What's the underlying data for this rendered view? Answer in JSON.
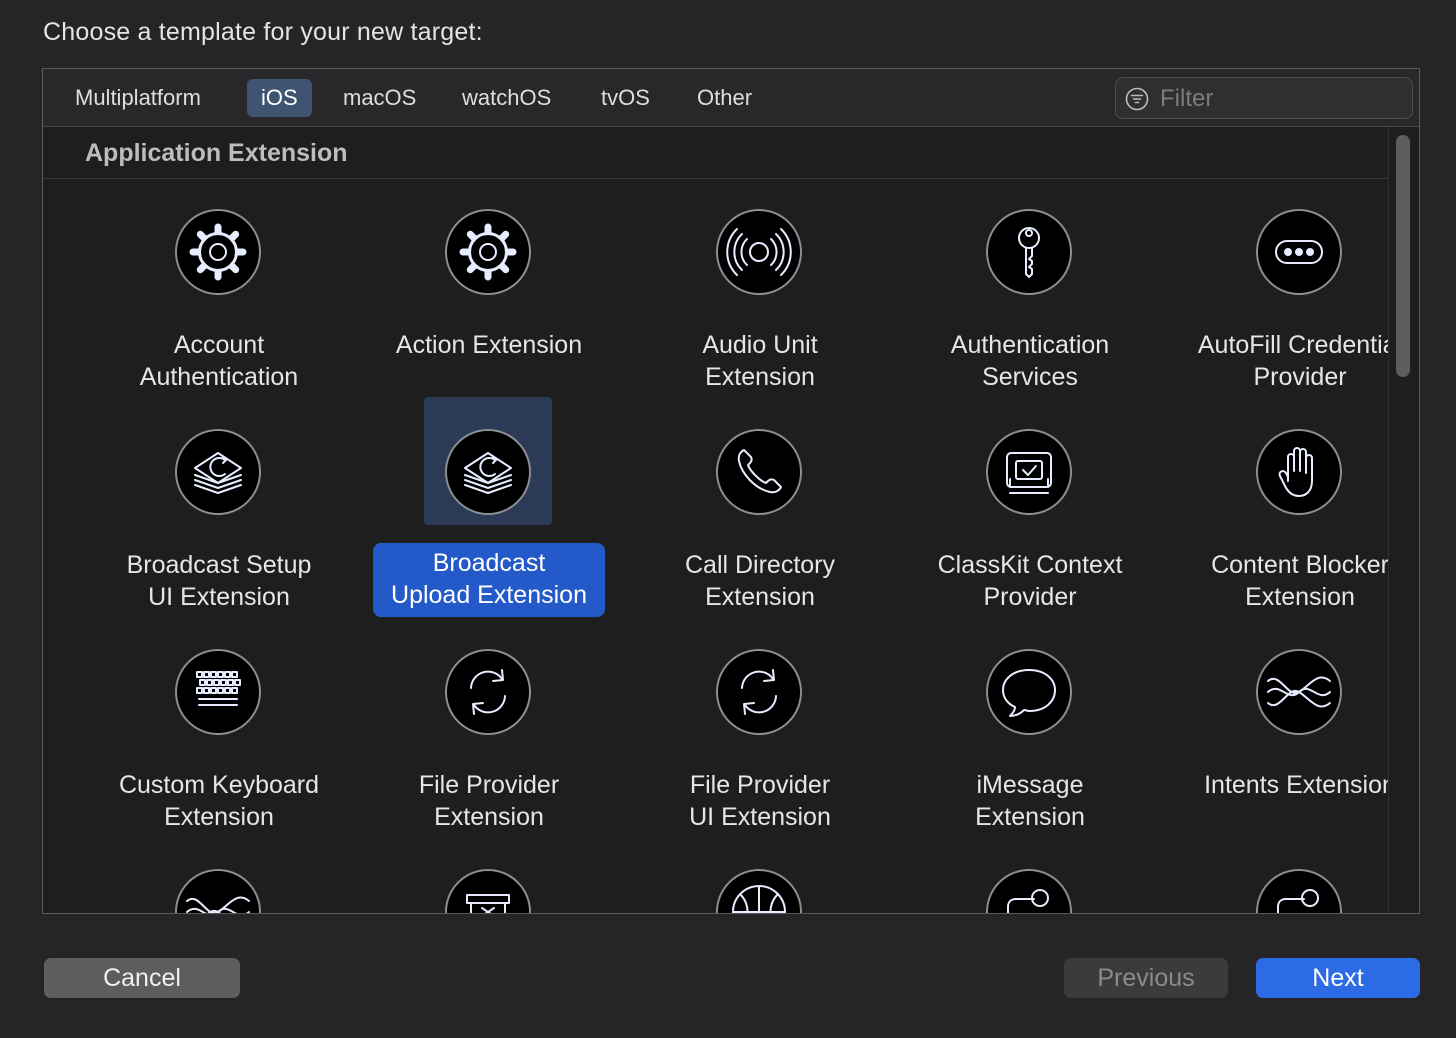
{
  "prompt": "Choose a template for your new target:",
  "tabs": [
    {
      "label": "Multiplatform",
      "active": false
    },
    {
      "label": "iOS",
      "active": true
    },
    {
      "label": "macOS",
      "active": false
    },
    {
      "label": "watchOS",
      "active": false
    },
    {
      "label": "tvOS",
      "active": false
    },
    {
      "label": "Other",
      "active": false
    }
  ],
  "filter": {
    "placeholder": "Filter",
    "value": "",
    "icon": "filter-icon"
  },
  "section": {
    "title": "Application Extension"
  },
  "templates": [
    {
      "label": "Account\nAuthentication",
      "icon": "gear-icon"
    },
    {
      "label": "Action Extension",
      "icon": "gear-icon"
    },
    {
      "label": "Audio Unit\nExtension",
      "icon": "audio-waves-icon"
    },
    {
      "label": "Authentication\nServices",
      "icon": "key-icon"
    },
    {
      "label": "AutoFill Credential\nProvider",
      "icon": "password-dots-icon"
    },
    {
      "label": "Broadcast Setup\nUI Extension",
      "icon": "broadcast-stack-icon"
    },
    {
      "label": "Broadcast\nUpload Extension",
      "icon": "broadcast-stack-icon",
      "selected": true
    },
    {
      "label": "Call Directory\nExtension",
      "icon": "phone-icon"
    },
    {
      "label": "ClassKit Context\nProvider",
      "icon": "classkit-checkmark-icon"
    },
    {
      "label": "Content Blocker\nExtension",
      "icon": "hand-icon"
    },
    {
      "label": "Custom Keyboard\nExtension",
      "icon": "keyboard-icon"
    },
    {
      "label": "File Provider\nExtension",
      "icon": "sync-arrows-icon"
    },
    {
      "label": "File Provider\nUI Extension",
      "icon": "sync-arrows-icon"
    },
    {
      "label": "iMessage\nExtension",
      "icon": "speech-bubble-icon"
    },
    {
      "label": "Intents Extension",
      "icon": "intents-waves-icon"
    },
    {
      "label": "",
      "icon": "intents-waves-icon"
    },
    {
      "label": "",
      "icon": "box-icon"
    },
    {
      "label": "",
      "icon": "basketball-icon"
    },
    {
      "label": "",
      "icon": "notification-icon"
    },
    {
      "label": "",
      "icon": "notification-icon"
    }
  ],
  "buttons": {
    "cancel": "Cancel",
    "previous": "Previous",
    "next": "Next"
  }
}
